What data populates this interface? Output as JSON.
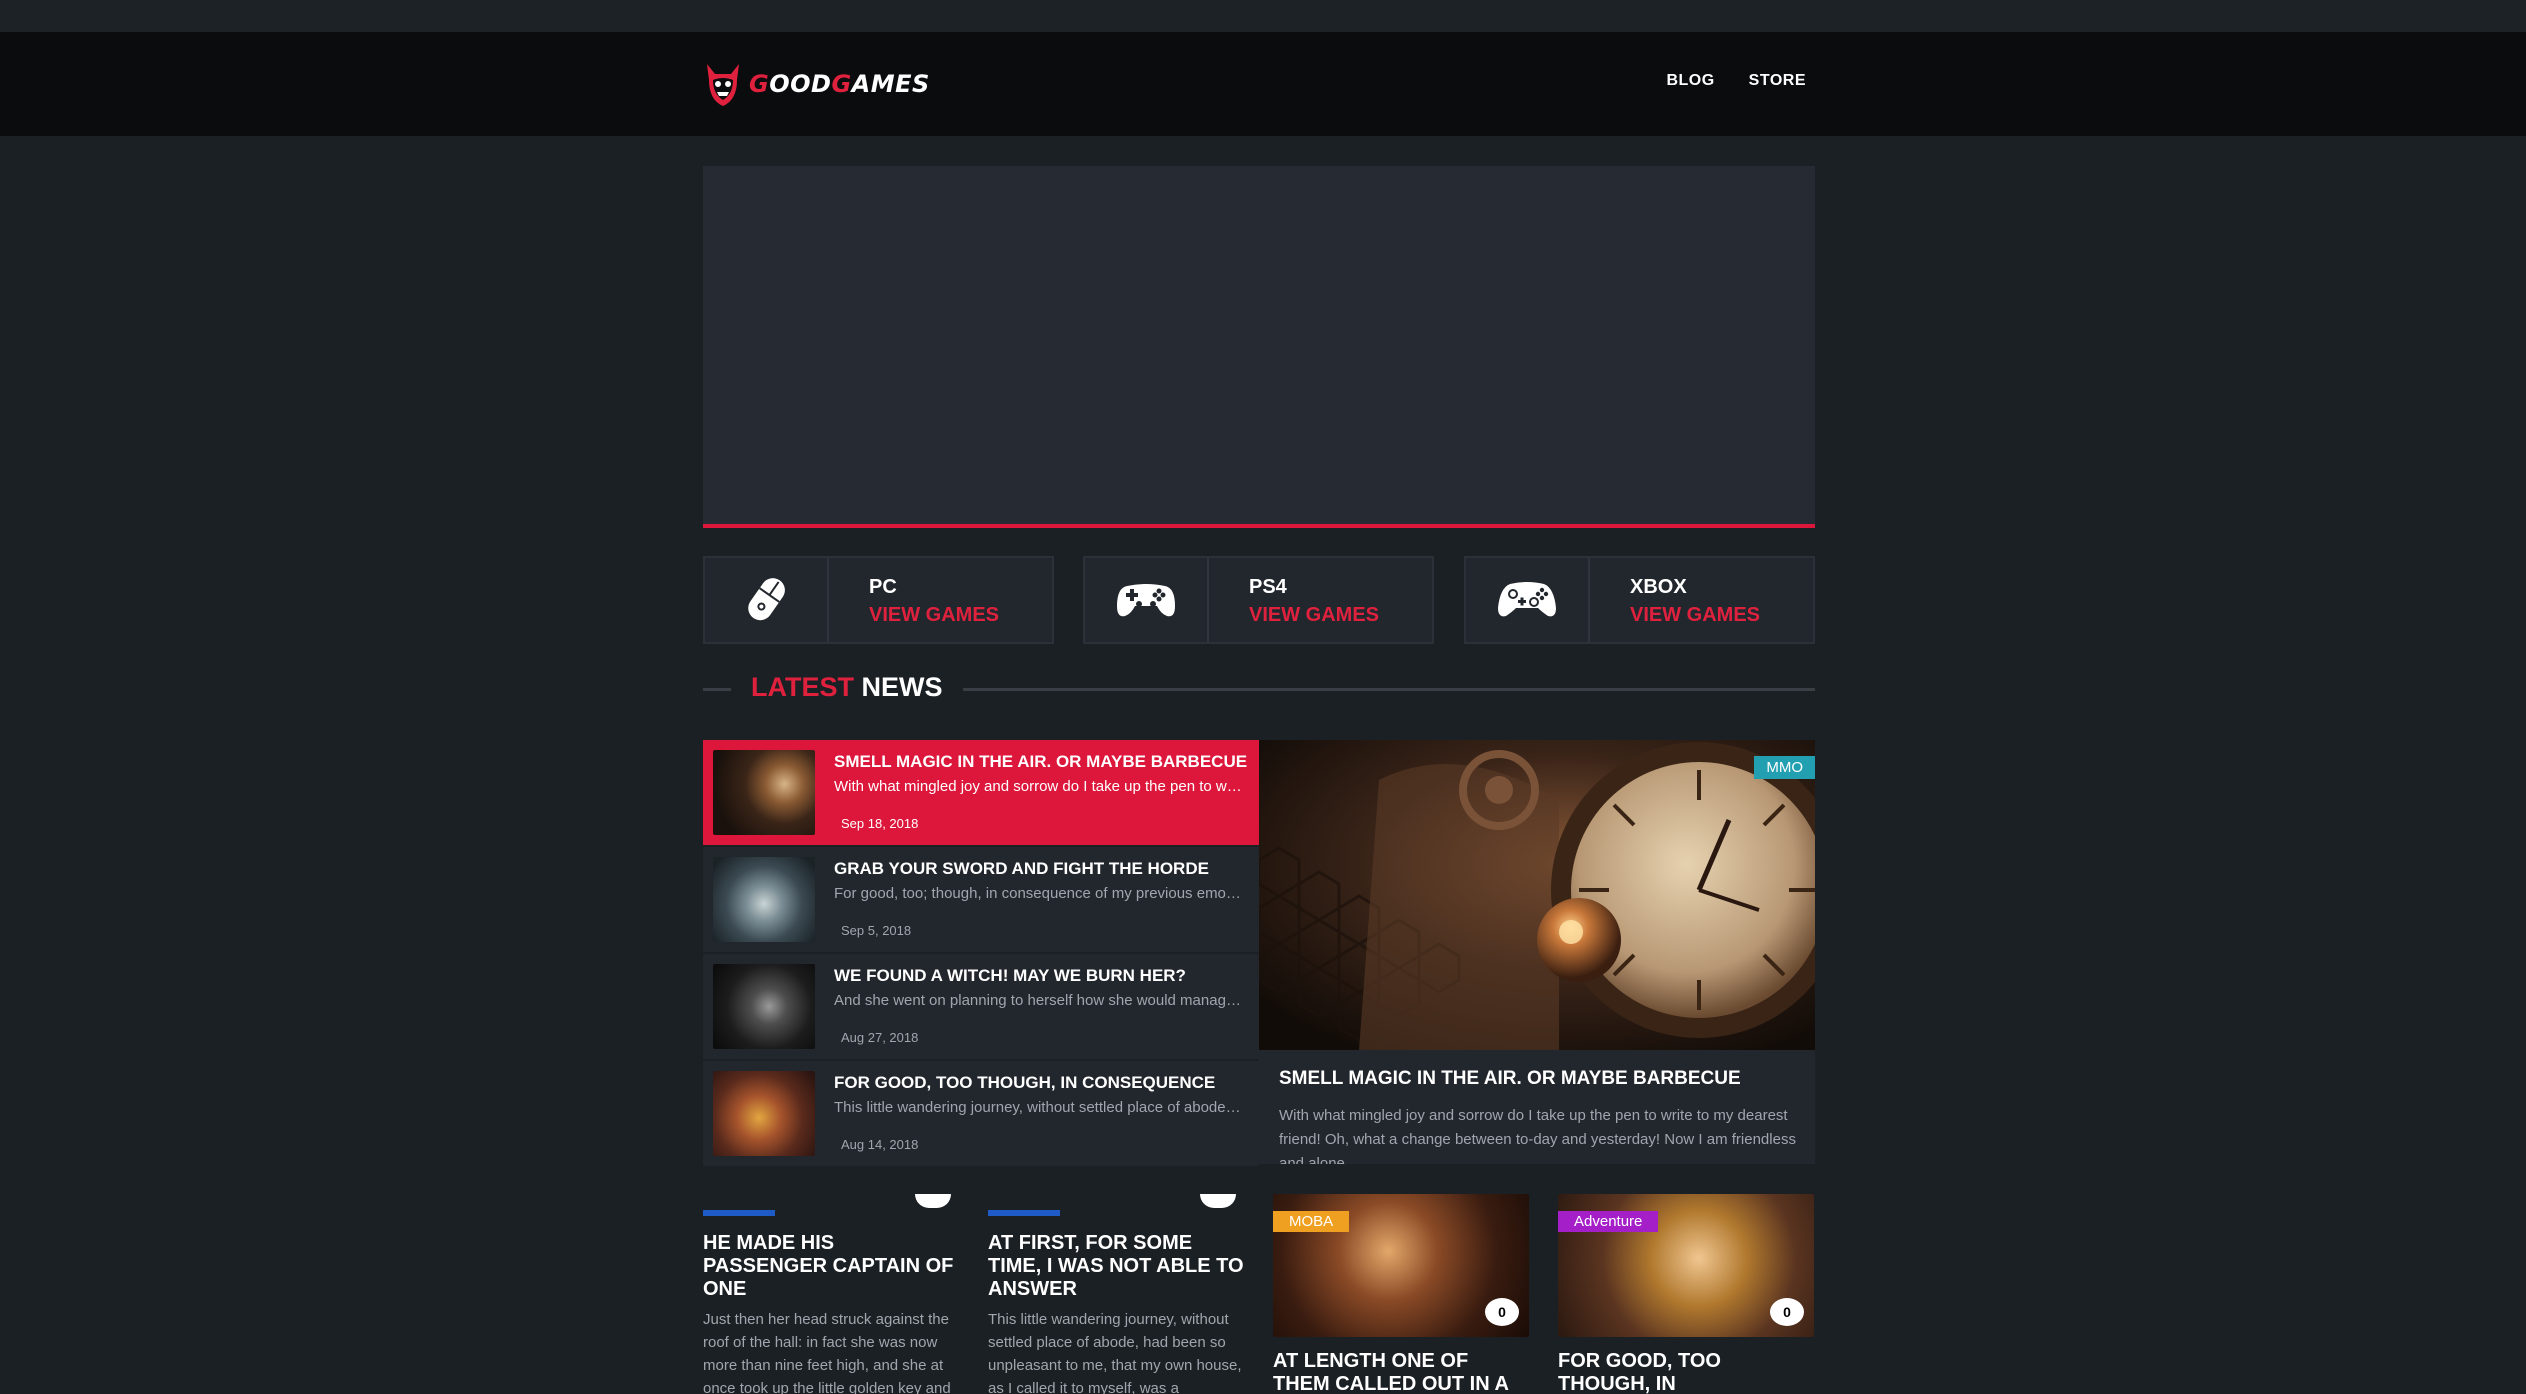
{
  "brand": {
    "name_prefix": "GOOD",
    "name_suffix": "GAMES",
    "accent": "#e0213e"
  },
  "nav": {
    "items": [
      "BLOG",
      "STORE"
    ]
  },
  "platforms": [
    {
      "name": "PC",
      "link": "VIEW GAMES",
      "icon": "mouse-icon"
    },
    {
      "name": "PS4",
      "link": "VIEW GAMES",
      "icon": "gamepad-icon"
    },
    {
      "name": "XBOX",
      "link": "VIEW GAMES",
      "icon": "xbox-controller-icon"
    }
  ],
  "latest_news": {
    "title_red": "LATEST",
    "title_white": "NEWS",
    "items": [
      {
        "title": "SMELL MAGIC IN THE AIR. OR MAYBE BARBECUE",
        "excerpt": "With what mingled joy and sorrow do I take up the pen to write to my dearest friend!",
        "date": "Sep 18, 2018",
        "active": true
      },
      {
        "title": "GRAB YOUR SWORD AND FIGHT THE HORDE",
        "excerpt": "For good, too; though, in consequence of my previous emotions, I was still occasionally seized with a stormy sob.",
        "date": "Sep 5, 2018",
        "active": false
      },
      {
        "title": "WE FOUND A WITCH! MAY WE BURN HER?",
        "excerpt": "And she went on planning to herself how she would manage it.",
        "date": "Aug 27, 2018",
        "active": false
      },
      {
        "title": "FOR GOOD, TOO THOUGH, IN CONSEQUENCE",
        "excerpt": "This little wandering journey, without settled place of abode, had been so unpleasant to me.",
        "date": "Aug 14, 2018",
        "active": false
      }
    ],
    "featured": {
      "badge": "MMO",
      "title": "SMELL MAGIC IN THE AIR. OR MAYBE BARBECUE",
      "excerpt": "With what mingled joy and sorrow do I take up the pen to write to my dearest friend! Oh, what a change between to-day and yesterday! Now I am friendless and alone."
    }
  },
  "cards": [
    {
      "title": "HE MADE HIS PASSENGER CAPTAIN OF ONE",
      "excerpt": "Just then her head struck against the roof of the hall: in fact she was now more than nine feet high, and she at once took up the little golden key and"
    },
    {
      "title": "AT FIRST, FOR SOME TIME, I WAS NOT ABLE TO ANSWER",
      "excerpt": "This little wandering journey, without settled place of abode, had been so unpleasant to me, that my own house, as I called it to myself, was a"
    },
    {
      "tag": "MOBA",
      "tag_color": "#f0a020",
      "comments": "0",
      "title": "AT LENGTH ONE OF THEM CALLED OUT IN A"
    },
    {
      "tag": "Adventure",
      "tag_color": "#a41fc8",
      "comments": "0",
      "title": "FOR GOOD, TOO THOUGH, IN"
    }
  ]
}
